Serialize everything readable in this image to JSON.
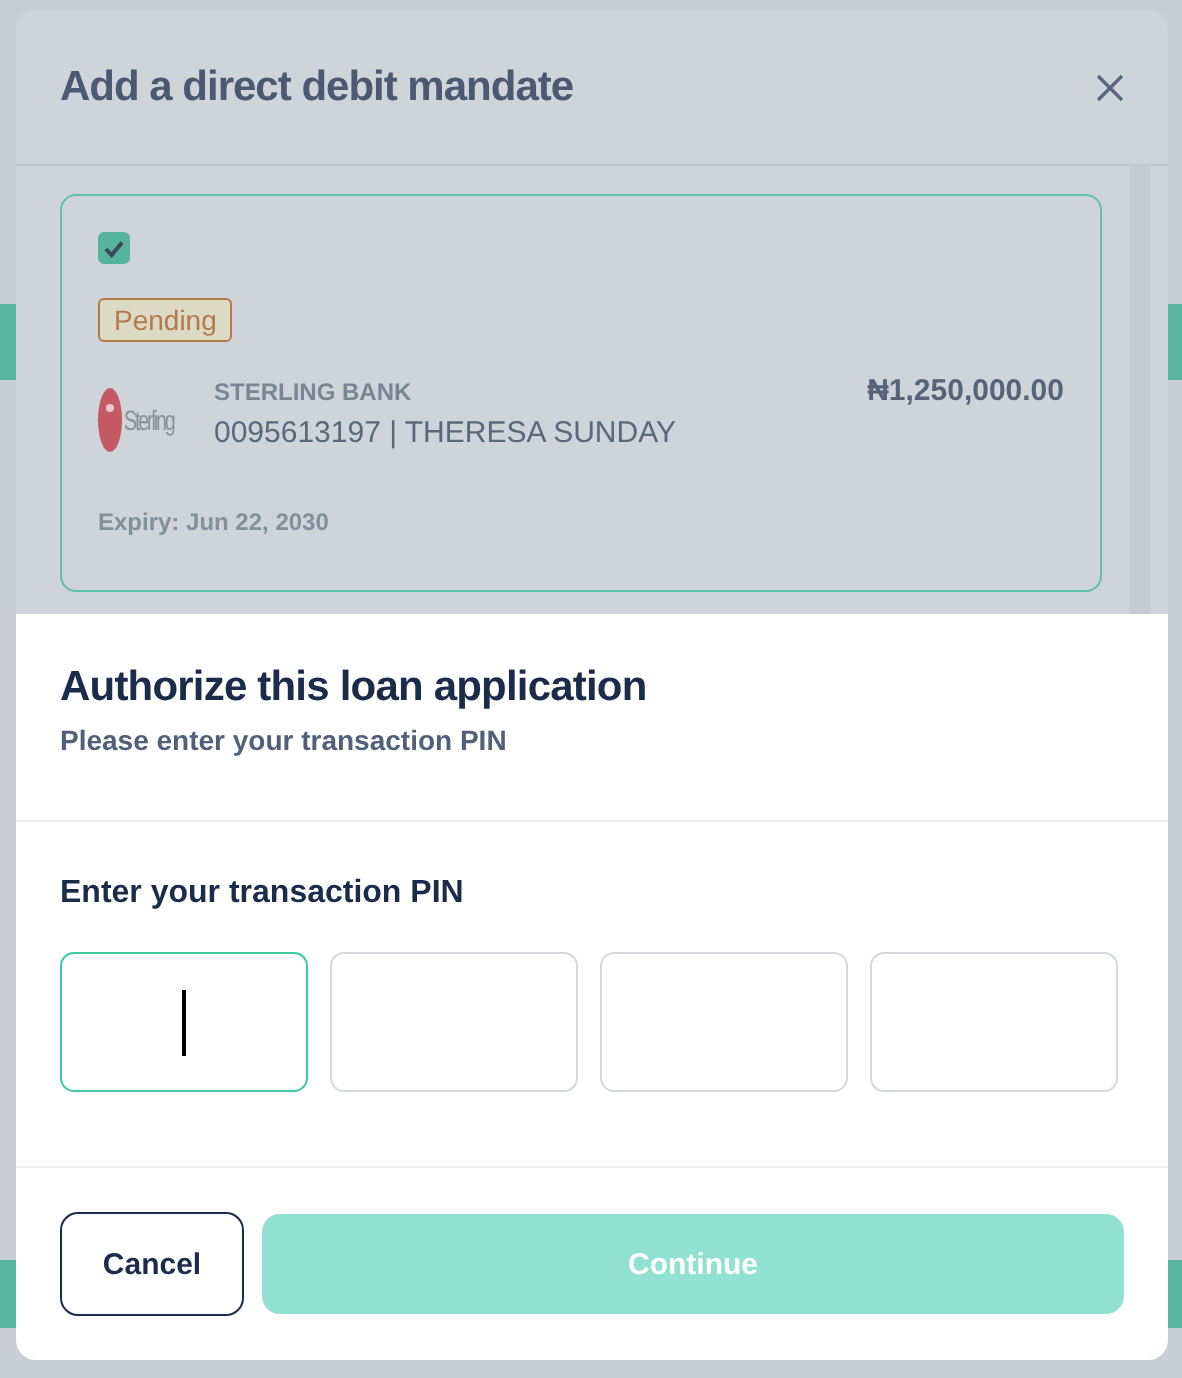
{
  "mandate_dialog": {
    "title": "Add a direct debit mandate",
    "mandate": {
      "checked": true,
      "status": "Pending",
      "bank_logo_text": "Sterling",
      "bank": "STERLING BANK",
      "account": "0095613197 | THERESA SUNDAY",
      "amount": "₦1,250,000.00",
      "expiry": "Expiry: Jun 22, 2030"
    }
  },
  "pin_sheet": {
    "title": "Authorize this loan application",
    "subtitle": "Please enter your transaction PIN",
    "pin_label": "Enter your transaction PIN",
    "pin_fields": [
      {
        "focused": true
      },
      {
        "focused": false
      },
      {
        "focused": false
      },
      {
        "focused": false
      }
    ],
    "buttons": [
      {
        "kind": "secondary",
        "label": "Cancel",
        "disabled": false
      },
      {
        "kind": "primary",
        "label": "Continue",
        "disabled": true
      }
    ]
  }
}
